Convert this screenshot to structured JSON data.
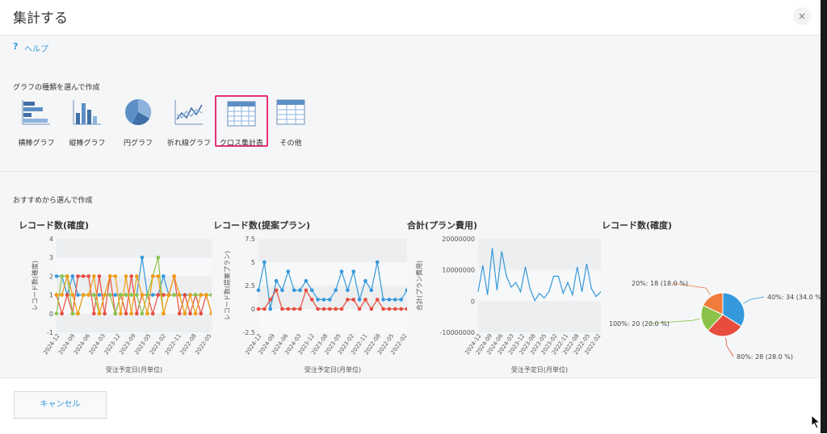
{
  "dialog": {
    "title": "集計する",
    "close_label": "×"
  },
  "help": {
    "icon": "?",
    "label": "ヘルプ"
  },
  "graph_types": {
    "heading": "グラフの種類を選んで作成",
    "items": [
      {
        "label": "横棒グラフ",
        "icon": "horizontal-bar-chart-icon"
      },
      {
        "label": "縦棒グラフ",
        "icon": "vertical-bar-chart-icon"
      },
      {
        "label": "円グラフ",
        "icon": "pie-chart-icon"
      },
      {
        "label": "折れ線グラフ",
        "icon": "line-chart-icon"
      },
      {
        "label": "クロス集計表",
        "icon": "cross-table-icon",
        "selected": true
      },
      {
        "label": "その他",
        "icon": "table-icon"
      }
    ]
  },
  "recommended": {
    "heading": "おすすめから選んで作成"
  },
  "colors": {
    "accent": "#3498db",
    "selected_border": "#e4307a",
    "series": [
      "#3498db",
      "#e74c3c",
      "#8bc34a",
      "#f39c12",
      "#f07c3c"
    ]
  },
  "chart_data": [
    {
      "type": "line",
      "title": "レコード数(確度)",
      "xlabel": "受注予定日(月単位)",
      "ylabel": "レコード数(確度)",
      "ylim": [
        -1,
        4
      ],
      "yticks": [
        "4",
        "3",
        "2",
        "1",
        "0",
        "-1"
      ],
      "xticks": [
        "2024-12",
        "2024-09",
        "2024-06",
        "2024-03",
        "2023-12",
        "2023-09",
        "2023-05",
        "2023-02",
        "2022-11",
        "2022-08",
        "2022-05"
      ],
      "series": [
        {
          "color": "#3498db",
          "values": [
            2,
            2,
            1,
            2,
            1,
            1,
            1,
            1,
            1,
            1,
            1,
            1,
            1,
            1,
            1,
            1,
            3,
            1,
            1,
            1,
            2,
            1,
            1,
            1,
            1,
            1,
            1,
            1,
            1,
            1
          ]
        },
        {
          "color": "#e74c3c",
          "values": [
            1,
            0,
            1,
            0,
            2,
            2,
            2,
            0,
            2,
            0,
            2,
            0,
            1,
            0,
            2,
            0,
            1,
            1,
            0,
            1,
            1,
            1,
            2,
            0,
            1,
            0,
            1,
            0,
            1,
            0
          ]
        },
        {
          "color": "#8bc34a",
          "values": [
            0,
            2,
            2,
            0,
            0,
            1,
            1,
            1,
            0,
            1,
            1,
            0,
            1,
            1,
            1,
            1,
            0,
            1,
            2,
            3,
            0,
            1,
            1,
            1,
            0,
            1,
            1,
            1,
            1,
            1
          ]
        },
        {
          "color": "#f39c12",
          "values": [
            1,
            1,
            2,
            1,
            0,
            1,
            1,
            2,
            0,
            1,
            2,
            2,
            0,
            2,
            0,
            2,
            1,
            0,
            2,
            2,
            0,
            1,
            2,
            1,
            0,
            1,
            0,
            1,
            1,
            0
          ]
        }
      ]
    },
    {
      "type": "line",
      "title": "レコード数(提案プラン)",
      "xlabel": "受注予定日(月単位)",
      "ylabel": "レコード数(提案プラン)",
      "ylim": [
        -2.5,
        7.5
      ],
      "yticks": [
        "7.5",
        "5",
        "2.5",
        "0",
        "-2.5"
      ],
      "xticks": [
        "2024-12",
        "2024-09",
        "2024-06",
        "2024-03",
        "2023-12",
        "2023-08",
        "2023-05",
        "2023-02",
        "2022-11",
        "2022-08",
        "2022-05",
        "2022-02"
      ],
      "series": [
        {
          "color": "#3498db",
          "values": [
            2,
            5,
            0,
            3,
            2,
            4,
            2,
            2,
            3,
            2,
            1,
            1,
            1,
            2,
            4,
            2,
            4,
            1,
            3,
            2,
            5,
            1,
            1,
            1,
            1,
            2
          ]
        },
        {
          "color": "#e74c3c",
          "values": [
            0,
            0,
            1,
            2,
            0,
            0,
            0,
            0,
            2,
            1,
            0,
            0,
            0,
            0,
            0,
            1,
            1,
            0,
            1,
            0,
            1,
            0,
            0,
            0,
            0,
            0
          ]
        }
      ]
    },
    {
      "type": "line",
      "title": "合計(プラン費用)",
      "xlabel": "受注予定日(月単位)",
      "ylabel": "合計(プラン費用)",
      "ylim": [
        -10000000,
        20000000
      ],
      "yticks": [
        "20000000",
        "10000000",
        "0",
        "-10000000"
      ],
      "xticks": [
        "2024-12",
        "2024-09",
        "2024-06",
        "2024-03",
        "2023-12",
        "2023-08",
        "2023-05",
        "2023-02",
        "2022-11",
        "2022-08",
        "2022-05",
        "2022-02"
      ],
      "series": [
        {
          "color": "#3498db",
          "values": [
            3000000,
            11500000,
            2000000,
            17000000,
            3500000,
            16000000,
            8000000,
            4500000,
            6000000,
            3000000,
            11000000,
            4000000,
            200000,
            2500000,
            1000000,
            3000000,
            8000000,
            8000000,
            2500000,
            6000000,
            2000000,
            11000000,
            3000000,
            12000000,
            4000000,
            1500000,
            3000000
          ]
        }
      ]
    },
    {
      "type": "pie",
      "title": "レコード数(確度)",
      "slices": [
        {
          "label": "40%: 34 (34.0 %)",
          "value": 34,
          "color": "#3498db"
        },
        {
          "label": "80%: 28 (28.0 %)",
          "value": 28,
          "color": "#e74c3c"
        },
        {
          "label": "100%: 20 (20.0 %)",
          "value": 20,
          "color": "#8bc34a"
        },
        {
          "label": "20%: 18 (18.0 %)",
          "value": 18,
          "color": "#f07c3c"
        }
      ]
    }
  ],
  "footer": {
    "cancel_label": "キャンセル"
  }
}
